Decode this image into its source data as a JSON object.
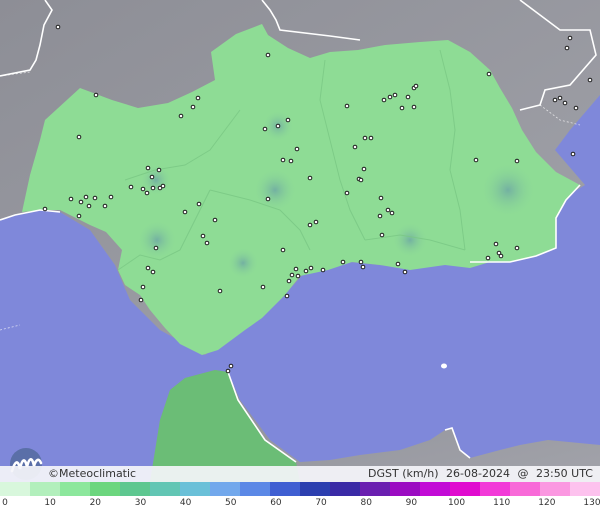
{
  "branding": {
    "name": "Meteoclimatic",
    "copyright_symbol": "©"
  },
  "info": {
    "parameter": "DGST (km/h)",
    "date": "26-08-2024",
    "at": "@",
    "time": "23:50 UTC"
  },
  "legend": {
    "ticks": [
      "0",
      "10",
      "20",
      "30",
      "40",
      "50",
      "60",
      "70",
      "80",
      "90",
      "100",
      "110",
      "120",
      "130"
    ],
    "colors": [
      "#d8f7dc",
      "#b2efbc",
      "#8ce79c",
      "#6cd67e",
      "#5ec790",
      "#62c6b4",
      "#6ac0d8",
      "#72a8ec",
      "#5b88e6",
      "#3f5fd2",
      "#2c3faf",
      "#3a2aa6",
      "#6a1fb0",
      "#9b0cc2",
      "#c20bd6",
      "#e00bcf",
      "#f23ad8",
      "#f86ad8",
      "#fb98e1",
      "#fdc2ee"
    ]
  },
  "map": {
    "land_color": "#8edc95",
    "sea_color": "#7f88da",
    "terrain_color": "#9a9ba2",
    "border_color": "#ffffff"
  }
}
